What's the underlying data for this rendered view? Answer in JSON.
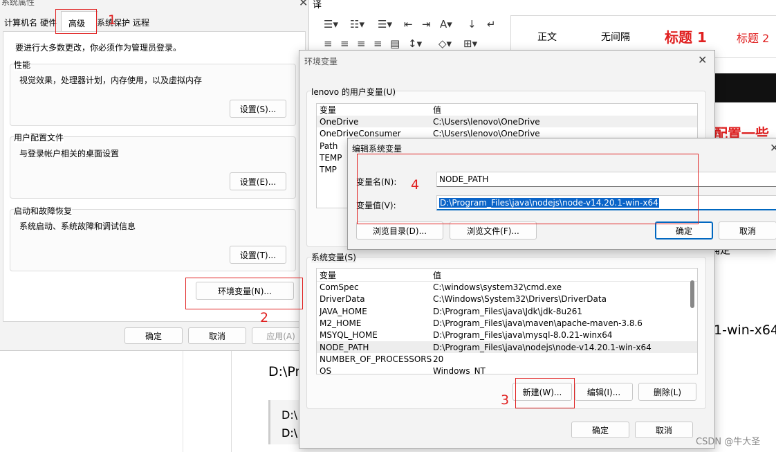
{
  "sysprops": {
    "title": "系统属性",
    "tabs": [
      "计算机名",
      "硬件",
      "高级",
      "系统保护",
      "远程"
    ],
    "admin_note": "要进行大多数更改，你必须作为管理员登录。",
    "perf": {
      "label": "性能",
      "desc": "视觉效果，处理器计划，内存使用，以及虚拟内存",
      "btn": "设置(S)..."
    },
    "profile": {
      "label": "用户配置文件",
      "desc": "与登录帐户相关的桌面设置",
      "btn": "设置(E)..."
    },
    "startup": {
      "label": "启动和故障恢复",
      "desc": "系统启动、系统故障和调试信息",
      "btn": "设置(T)..."
    },
    "env_btn": "环境变量(N)...",
    "ok": "确定",
    "cancel": "取消",
    "apply": "应用(A)"
  },
  "env": {
    "title": "环境变量",
    "user_label": "lenovo 的用户变量(U)",
    "col_var": "变量",
    "col_val": "值",
    "user_rows": [
      {
        "name": "OneDrive",
        "value": "C:\\Users\\lenovo\\OneDrive"
      },
      {
        "name": "OneDriveConsumer",
        "value": "C:\\Users\\lenovo\\OneDrive"
      },
      {
        "name": "Path",
        "value": ""
      },
      {
        "name": "TEMP",
        "value": ""
      },
      {
        "name": "TMP",
        "value": ""
      }
    ],
    "sys_label": "系统变量(S)",
    "sys_rows": [
      {
        "name": "ComSpec",
        "value": "C:\\windows\\system32\\cmd.exe"
      },
      {
        "name": "DriverData",
        "value": "C:\\Windows\\System32\\Drivers\\DriverData"
      },
      {
        "name": "JAVA_HOME",
        "value": "D:\\Program_Files\\java\\Jdk\\jdk-8u261"
      },
      {
        "name": "M2_HOME",
        "value": "D:\\Program_Files\\java\\maven\\apache-maven-3.8.6"
      },
      {
        "name": "MSYQL_HOME",
        "value": "D:\\Program_Files\\java\\mysql-8.0.21-winx64"
      },
      {
        "name": "NODE_PATH",
        "value": "D:\\Program_Files\\java\\nodejs\\node-v14.20.1-win-x64"
      },
      {
        "name": "NUMBER_OF_PROCESSORS",
        "value": "20"
      },
      {
        "name": "OS",
        "value": "Windows_NT"
      }
    ],
    "new_btn": "新建(W)...",
    "edit_btn": "编辑(I)...",
    "delete_btn": "删除(L)",
    "ok": "确定",
    "cancel": "取消"
  },
  "editvar": {
    "title": "编辑系统变量",
    "name_label": "变量名(N):",
    "name_value": "NODE_PATH",
    "value_label": "变量值(V):",
    "value_value": "D:\\Program_Files\\java\\nodejs\\node-v14.20.1-win-x64",
    "browse_dir": "浏览目录(D)...",
    "browse_file": "浏览文件(F)...",
    "ok": "确定",
    "cancel": "取消"
  },
  "word": {
    "styles": [
      "正文",
      "无间隔",
      "标题 1",
      "标题 2"
    ],
    "heading_red": "要配置一些",
    "text_right": "1-win-x64",
    "text_confirm": "确定",
    "doc_line": "D:\\Pr",
    "code_lines": [
      "D:\\",
      "D:\\",
      "D:\\"
    ],
    "tab_char": "译"
  },
  "annotations": [
    "1",
    "2",
    "3",
    "4"
  ],
  "watermark": "CSDN @牛大圣",
  "colors": {
    "red": "#e02020",
    "accent": "#0067c0",
    "select": "#0a64c8"
  }
}
